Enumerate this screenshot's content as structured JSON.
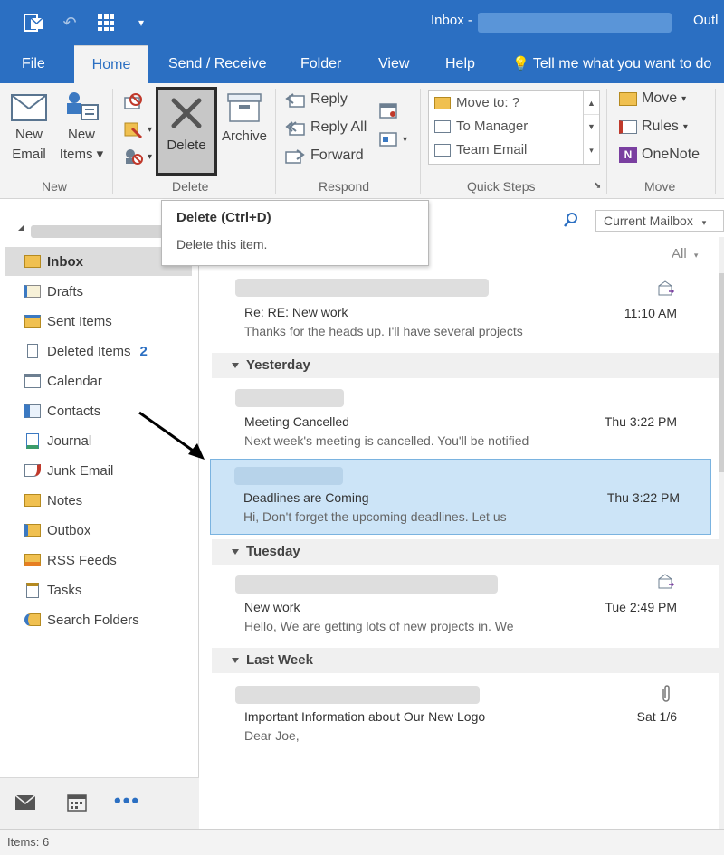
{
  "titlebar": {
    "title": "Inbox -",
    "app": "Outl"
  },
  "tabs": [
    {
      "label": "File"
    },
    {
      "label": "Home"
    },
    {
      "label": "Send / Receive"
    },
    {
      "label": "Folder"
    },
    {
      "label": "View"
    },
    {
      "label": "Help"
    }
  ],
  "tellme": "Tell me what you want to do",
  "ribbon": {
    "new": {
      "new_email_1": "New",
      "new_email_2": "Email",
      "new_items_1": "New",
      "new_items_2": "Items",
      "group": "New"
    },
    "delete": {
      "delete": "Delete",
      "archive": "Archive",
      "group": "Delete"
    },
    "respond": {
      "reply": "Reply",
      "reply_all": "Reply All",
      "forward": "Forward",
      "group": "Respond"
    },
    "quicksteps": {
      "move_to": "Move to: ?",
      "to_manager": "To Manager",
      "team_email": "Team Email",
      "group": "Quick Steps"
    },
    "move": {
      "move": "Move",
      "rules": "Rules",
      "onenote": "OneNote",
      "group": "Move"
    }
  },
  "tooltip": {
    "title": "Delete (Ctrl+D)",
    "description": "Delete this item."
  },
  "search": {
    "scope": "Current Mailbox"
  },
  "filter": "All",
  "folders": [
    {
      "label": "Inbox",
      "icon": "inbox-icon",
      "active": true
    },
    {
      "label": "Drafts",
      "icon": "drafts-icon"
    },
    {
      "label": "Sent Items",
      "icon": "sent-icon"
    },
    {
      "label": "Deleted Items",
      "icon": "trash-icon",
      "count": "2"
    },
    {
      "label": "Calendar",
      "icon": "calendar-icon"
    },
    {
      "label": "Contacts",
      "icon": "contacts-icon"
    },
    {
      "label": "Journal",
      "icon": "journal-icon"
    },
    {
      "label": "Junk Email",
      "icon": "junk-icon"
    },
    {
      "label": "Notes",
      "icon": "notes-icon"
    },
    {
      "label": "Outbox",
      "icon": "outbox-icon"
    },
    {
      "label": "RSS Feeds",
      "icon": "rss-icon"
    },
    {
      "label": "Tasks",
      "icon": "tasks-icon"
    },
    {
      "label": "Search Folders",
      "icon": "search-folder-icon"
    }
  ],
  "groups": [
    {
      "label": "Yesterday"
    },
    {
      "label": "Tuesday"
    },
    {
      "label": "Last Week"
    }
  ],
  "messages": [
    {
      "subject": "Re: RE: New work",
      "preview": "Thanks for the heads up. I'll have several projects",
      "time": "11:10 AM",
      "icon": "reply-icon"
    },
    {
      "subject": "Meeting Cancelled",
      "preview": "Next week's meeting is cancelled.  You'll be notified",
      "time": "Thu 3:22 PM"
    },
    {
      "subject": "Deadlines are Coming",
      "preview": "Hi,  Don't forget the upcoming deadlines.  Let us",
      "time": "Thu 3:22 PM",
      "selected": true
    },
    {
      "subject": "New work",
      "preview": "Hello,  We are getting lots of new projects in. We",
      "time": "Tue 2:49 PM",
      "icon": "reply-icon"
    },
    {
      "subject": "Important Information about Our New Logo",
      "preview": "Dear Joe,",
      "time": "Sat 1/6",
      "icon": "paperclip-icon"
    }
  ],
  "status": {
    "items": "Items: 6"
  },
  "colors": {
    "accent": "#2b6fc2",
    "selected": "#cce4f7"
  }
}
